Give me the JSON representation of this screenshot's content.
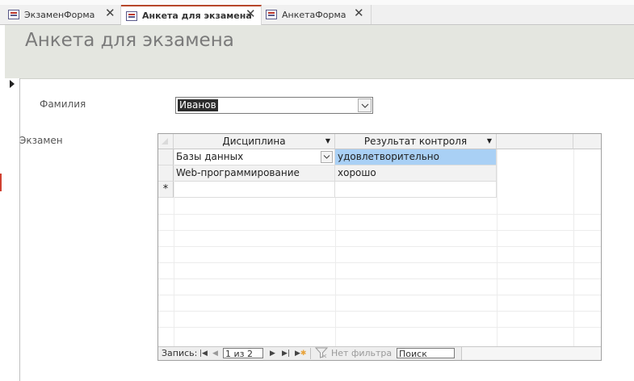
{
  "tabs": [
    {
      "label": "ЭкзаменФорма",
      "active": false
    },
    {
      "label": "Анкета для экзамена",
      "active": true
    },
    {
      "label": "АнкетаФорма",
      "active": false
    }
  ],
  "form": {
    "title": "Анкета для экзамена",
    "surname_label": "Фамилия",
    "surname_value": "Иванов",
    "exam_label": "Экзамен"
  },
  "subform": {
    "columns": [
      "Дисциплина",
      "Результат контроля"
    ],
    "rows": [
      [
        "Базы данных",
        "удовлетворительно"
      ],
      [
        "Web-программирование",
        "хорошо"
      ]
    ],
    "new_row_marker": "*"
  },
  "navbar": {
    "record_label": "Запись:",
    "position": "1 из 2",
    "filter_label": "Нет фильтра",
    "search_placeholder": "Поиск"
  },
  "colors": {
    "accent": "#b7472a",
    "header_bg": "#e4e6e0",
    "selection": "#a9d0f5"
  }
}
